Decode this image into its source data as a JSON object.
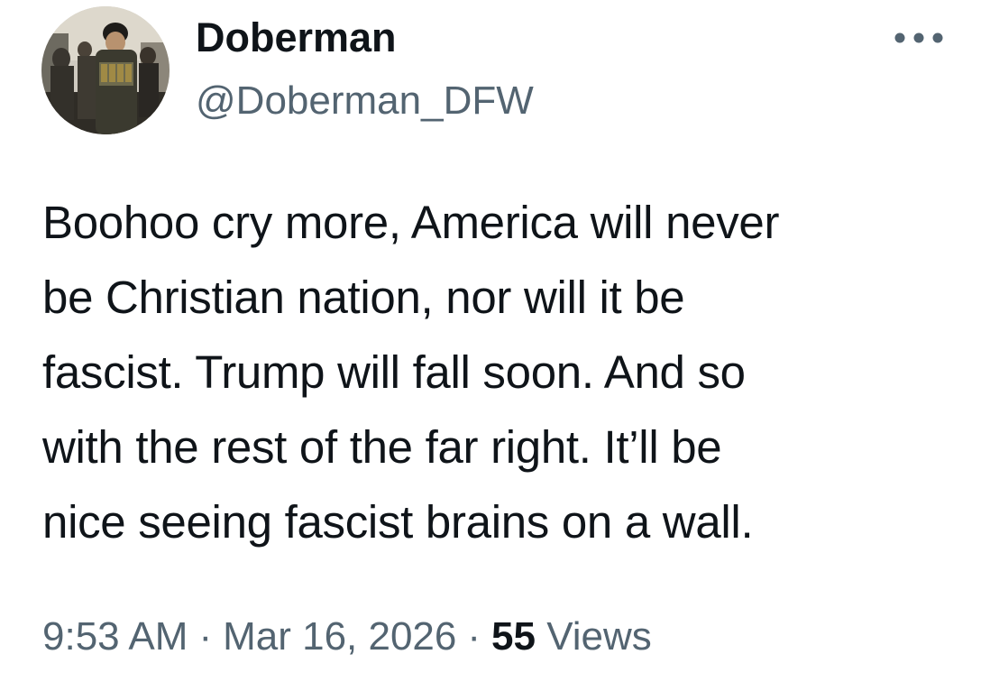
{
  "author": {
    "display_name": "Doberman",
    "handle": "@Doberman_DFW",
    "avatar_icon": "profile-photo"
  },
  "tweet": {
    "text": "Boohoo cry more, America will never\nbe Christian nation, nor will it be\nfascist. Trump will fall soon. And so\nwith the rest of the far right. It’ll be\nnice seeing fascist brains on a wall."
  },
  "meta": {
    "time": "9:53 AM",
    "separator": "·",
    "date": "Mar 16, 2026",
    "views_count": "55",
    "views_label": "Views"
  },
  "icons": {
    "more": "more-horizontal-icon"
  },
  "colors": {
    "text_primary": "#0f1419",
    "text_secondary": "#536471",
    "background": "#ffffff"
  }
}
